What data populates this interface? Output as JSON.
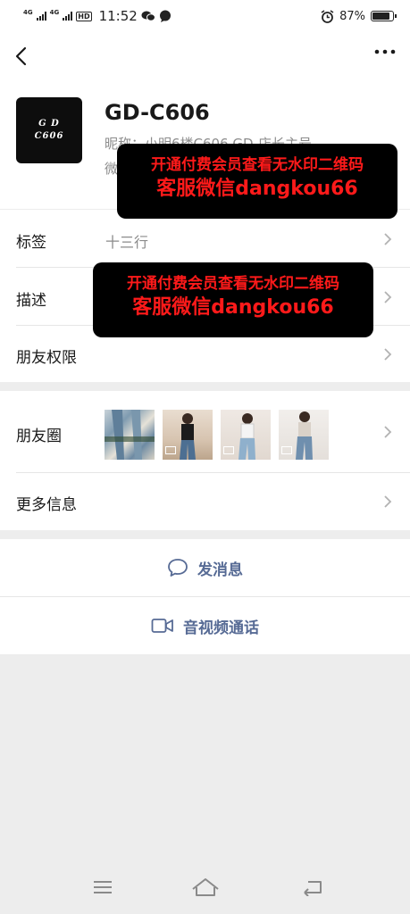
{
  "status_bar": {
    "network1": "4G",
    "network2": "4G",
    "hd_badge": "HD",
    "time": "11:52",
    "battery": "87%",
    "battery_level": 0.87
  },
  "contact": {
    "avatar_text": "G D\nC606",
    "name": "GD-C606",
    "nickname": "昵称：小明6楼C606 GD-店长主号",
    "wechat_id": "微"
  },
  "rows": {
    "tags_label": "标签",
    "tags_value": "十三行",
    "desc_label": "描述",
    "permission_label": "朋友权限",
    "moments_label": "朋友圈",
    "more_info_label": "更多信息"
  },
  "moments_thumbs": [
    {
      "icon": "jeans-photo",
      "video": false
    },
    {
      "icon": "person-video",
      "video": true
    },
    {
      "icon": "person-video",
      "video": true
    },
    {
      "icon": "person-video",
      "video": true
    }
  ],
  "actions": {
    "send_message": "发消息",
    "video_call": "音视频通话"
  },
  "watermark": {
    "line1": "开通付费会员查看无水印二维码",
    "line2": "客服微信dangkou66"
  },
  "colors": {
    "link_blue": "#576b95",
    "watermark_red": "#ff1a1a"
  }
}
